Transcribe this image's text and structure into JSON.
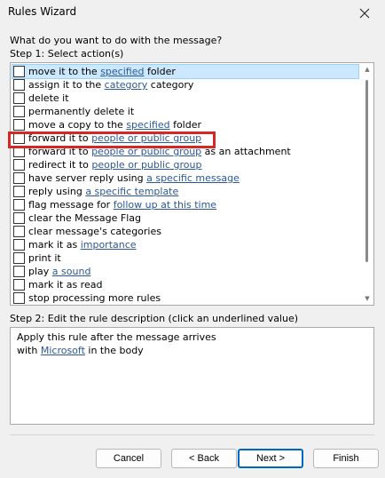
{
  "window": {
    "title": "Rules Wizard"
  },
  "prompt": "What do you want to do with the message?",
  "step1": {
    "label": "Step 1: Select action(s)",
    "items": [
      {
        "before": "move it to the ",
        "link": "specified",
        "after": " folder",
        "selected": true
      },
      {
        "before": "assign it to the ",
        "link": "category",
        "after": " category"
      },
      {
        "before": "delete it",
        "link": "",
        "after": ""
      },
      {
        "before": "permanently delete it",
        "link": "",
        "after": ""
      },
      {
        "before": "move a copy to the ",
        "link": "specified",
        "after": " folder"
      },
      {
        "before": "forward it to ",
        "link": "people or public group",
        "after": ""
      },
      {
        "before": "forward it to ",
        "link": "people or public group",
        "after": " as an attachment"
      },
      {
        "before": "redirect it to ",
        "link": "people or public group",
        "after": ""
      },
      {
        "before": "have server reply using ",
        "link": "a specific message",
        "after": ""
      },
      {
        "before": "reply using ",
        "link": "a specific template",
        "after": ""
      },
      {
        "before": "flag message for ",
        "link": "follow up at this time",
        "after": ""
      },
      {
        "before": "clear the Message Flag",
        "link": "",
        "after": ""
      },
      {
        "before": "clear message's categories",
        "link": "",
        "after": ""
      },
      {
        "before": "mark it as ",
        "link": "importance",
        "after": ""
      },
      {
        "before": "print it",
        "link": "",
        "after": ""
      },
      {
        "before": "play ",
        "link": "a sound",
        "after": ""
      },
      {
        "before": "mark it as read",
        "link": "",
        "after": ""
      },
      {
        "before": "stop processing more rules",
        "link": "",
        "after": ""
      }
    ]
  },
  "step2": {
    "label": "Step 2: Edit the rule description (click an underlined value)",
    "line1": "Apply this rule after the message arrives",
    "line2_before": "with ",
    "line2_link": "Microsoft",
    "line2_after": " in the body"
  },
  "buttons": {
    "cancel": "Cancel",
    "back": "< Back",
    "next": "Next >",
    "finish": "Finish"
  },
  "colors": {
    "link": "#2b5797",
    "highlight": "#d62727",
    "selected": "#cce8ff"
  }
}
